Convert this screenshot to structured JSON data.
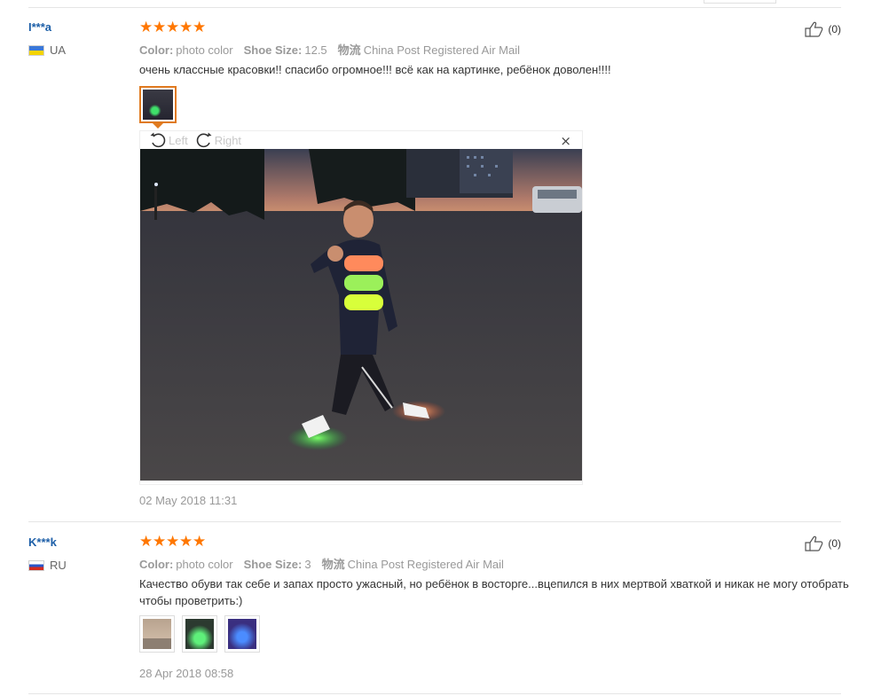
{
  "reviews": [
    {
      "user": "I***a",
      "country": "UA",
      "rating": 5,
      "color_label": "Color:",
      "color_value": "photo color",
      "size_label": "Shoe Size:",
      "size_value": "12.5",
      "shipping_label": "物流",
      "shipping_value": "China Post Registered Air Mail",
      "text": "очень классные красовки!! спасибо огромное!!! всё как на картинке, ребёнок доволен!!!!",
      "date": "02 May 2018 11:31",
      "likes": "(0)",
      "viewer": {
        "rotate_left": "Left",
        "rotate_right": "Right",
        "close": "×"
      }
    },
    {
      "user": "K***k",
      "country": "RU",
      "rating": 5,
      "color_label": "Color:",
      "color_value": "photo color",
      "size_label": "Shoe Size:",
      "size_value": "3",
      "shipping_label": "物流",
      "shipping_value": "China Post Registered Air Mail",
      "text": "Качество обуви так себе и запах просто ужасный, но ребёнок в восторге...вцепился в них мертвой хваткой и никак не могу отобрать чтобы проветрить:)",
      "date": "28 Apr 2018 08:58",
      "likes": "(0)"
    }
  ],
  "colors": {
    "star": "#ff7700",
    "username": "#1d5fa8",
    "active_thumb_border": "#e07a1f"
  },
  "icons": [
    "star-icon",
    "thumbs-up-icon",
    "rotate-left-icon",
    "rotate-right-icon",
    "close-icon",
    "flag-ua-icon",
    "flag-ru-icon"
  ]
}
